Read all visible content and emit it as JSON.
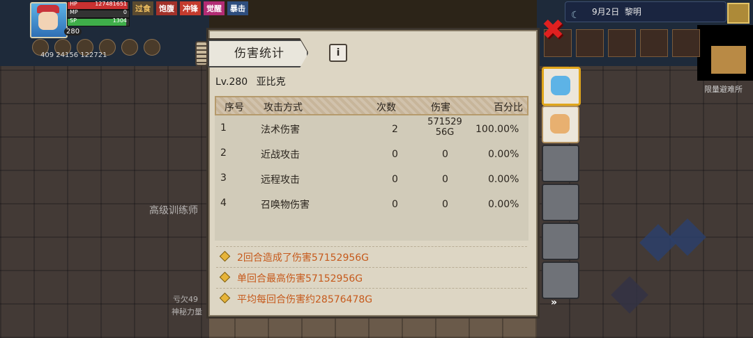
{
  "hud": {
    "hp_label": "HP",
    "hp_value": "127481651",
    "mp_label": "MP",
    "mp_value": "0",
    "sp_label": "SP",
    "sp_value": "1304",
    "level": "280",
    "tags": [
      "过食",
      "饱腹",
      "冲锋",
      "觉醒",
      "暴击"
    ],
    "stat_values": "409  24156  122721",
    "date": "9月2日",
    "time_of_day": "黎明",
    "area_label": "限量避难所",
    "ghost_text_1": "高级训练师",
    "ghost_text_2": "亏欠49",
    "ghost_text_3": "神秘力量"
  },
  "dialog": {
    "title": "伤害统计",
    "info_icon": "i",
    "player_level": "Lv.280",
    "player_name": "亚比克",
    "columns": [
      "序号",
      "攻击方式",
      "次数",
      "伤害",
      "百分比"
    ],
    "rows": [
      {
        "idx": "1",
        "type": "法术伤害",
        "count": "2",
        "damage_line1": "571529",
        "damage_line2": "56G",
        "pct": "100.00%"
      },
      {
        "idx": "2",
        "type": "近战攻击",
        "count": "0",
        "damage": "0",
        "pct": "0.00%"
      },
      {
        "idx": "3",
        "type": "远程攻击",
        "count": "0",
        "damage": "0",
        "pct": "0.00%"
      },
      {
        "idx": "4",
        "type": "召唤物伤害",
        "count": "0",
        "damage": "0",
        "pct": "0.00%"
      }
    ],
    "summary": [
      "2回合造成了伤害57152956G",
      "单回合最高伤害57152956G",
      "平均每回合伤害约28576478G"
    ]
  },
  "close_icon": "✖"
}
